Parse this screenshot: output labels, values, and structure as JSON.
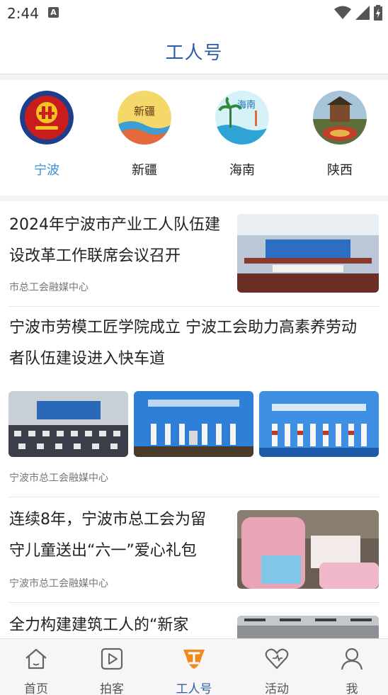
{
  "status": {
    "time": "2:44",
    "a_icon": "A"
  },
  "header": {
    "title": "工人号"
  },
  "channels": [
    {
      "label": "宁波",
      "icon": "ningbo-union-logo",
      "active": true
    },
    {
      "label": "新疆",
      "icon": "xinjiang-logo",
      "logo_text": "新疆"
    },
    {
      "label": "海南",
      "icon": "hainan-logo",
      "logo_text": "海南"
    },
    {
      "label": "陕西",
      "icon": "shaanxi-logo"
    }
  ],
  "articles": [
    {
      "title_line1": "2024年宁波市产业工人队伍建",
      "title_line2": "设改革工作联席会议召开",
      "source": "市总工会融媒中心"
    },
    {
      "title_line1": "宁波市劳模工匠学院成立 宁波工会助力高素养劳动",
      "title_line2": "者队伍建设进入快车道",
      "source": "宁波市总工会融媒中心"
    },
    {
      "title_line1": "连续8年，宁波市总工会为留",
      "title_line2": "守儿童送出“六一”爱心礼包",
      "source": "宁波市总工会融媒中心"
    },
    {
      "title_line1": "全力构建建筑工人的“新家"
    }
  ],
  "tabs": [
    {
      "label": "首页",
      "icon": "home-icon"
    },
    {
      "label": "拍客",
      "icon": "play-icon"
    },
    {
      "label": "工人号",
      "icon": "union-icon",
      "active": true
    },
    {
      "label": "活动",
      "icon": "heart-icon"
    },
    {
      "label": "我",
      "icon": "user-icon"
    }
  ],
  "colors": {
    "accent": "#2c5ea8",
    "active_channel": "#3d8fd8",
    "tab_inactive": "#555555"
  }
}
